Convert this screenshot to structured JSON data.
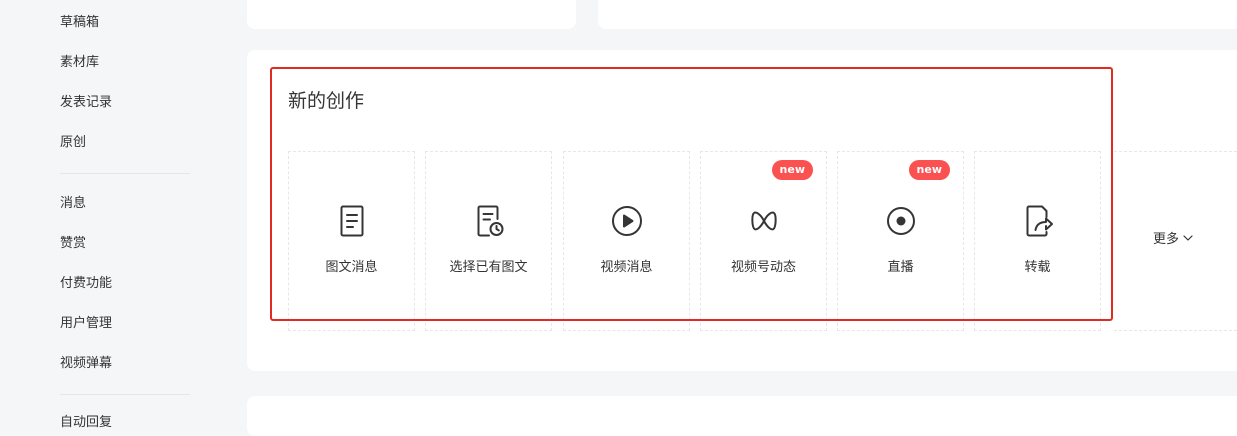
{
  "sidebar": {
    "items": [
      {
        "label": "草稿箱"
      },
      {
        "label": "素材库"
      },
      {
        "label": "发表记录"
      },
      {
        "label": "原创"
      },
      {
        "label": "消息"
      },
      {
        "label": "赞赏"
      },
      {
        "label": "付费功能"
      },
      {
        "label": "用户管理"
      },
      {
        "label": "视频弹幕"
      },
      {
        "label": "自动回复"
      }
    ]
  },
  "new_creation": {
    "title": "新的创作",
    "tiles": [
      {
        "label": "图文消息",
        "icon": "document-icon"
      },
      {
        "label": "选择已有图文",
        "icon": "document-clock-icon"
      },
      {
        "label": "视频消息",
        "icon": "play-icon"
      },
      {
        "label": "视频号动态",
        "icon": "channels-icon",
        "badge": "new"
      },
      {
        "label": "直播",
        "icon": "live-dot-icon",
        "badge": "new"
      },
      {
        "label": "转载",
        "icon": "share-icon"
      }
    ],
    "more_label": "更多"
  },
  "colors": {
    "badge": "#fa5151",
    "highlight": "#e02b20",
    "icon": "#353535"
  }
}
